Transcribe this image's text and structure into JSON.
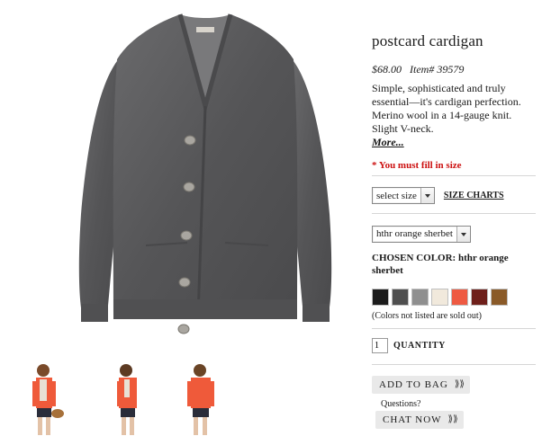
{
  "product": {
    "name": "postcard cardigan",
    "price": "$68.00",
    "item_number": "Item# 39579",
    "description": "Simple, sophisticated and truly essential—it's cardigan perfection. Merino wool in a 14-gauge knit. Slight V-neck.",
    "more_link": "More..."
  },
  "size": {
    "required_message": "* You must fill in size",
    "selected": "select size",
    "size_charts_link": "SIZE CHARTS"
  },
  "color": {
    "selected": "hthr orange sherbet",
    "chosen_label": "CHOSEN COLOR: hthr orange sherbet",
    "swatches": [
      {
        "name": "black",
        "hex": "#1c1c1c"
      },
      {
        "name": "charcoal",
        "hex": "#4f4f4f"
      },
      {
        "name": "grey",
        "hex": "#8f8f8f"
      },
      {
        "name": "ivory",
        "hex": "#f1e9dc"
      },
      {
        "name": "orange sherbet",
        "hex": "#ee5a42"
      },
      {
        "name": "burgundy",
        "hex": "#6e1f1a"
      },
      {
        "name": "tan",
        "hex": "#8a5a28"
      }
    ],
    "sold_out_note": "(Colors not listed are sold out)"
  },
  "quantity": {
    "value": "1",
    "label": "QUANTITY"
  },
  "actions": {
    "add_to_bag": "ADD TO BAG",
    "questions": "Questions?",
    "chat_now": "CHAT NOW",
    "chevron": "⟫⟫"
  },
  "colors": {
    "cardigan": "#58585a",
    "accent_red": "#cc1111",
    "button_bg": "#e9e9e9"
  },
  "thumbnails": [
    {
      "label": "front-styled"
    },
    {
      "label": "side"
    },
    {
      "label": "back"
    }
  ]
}
